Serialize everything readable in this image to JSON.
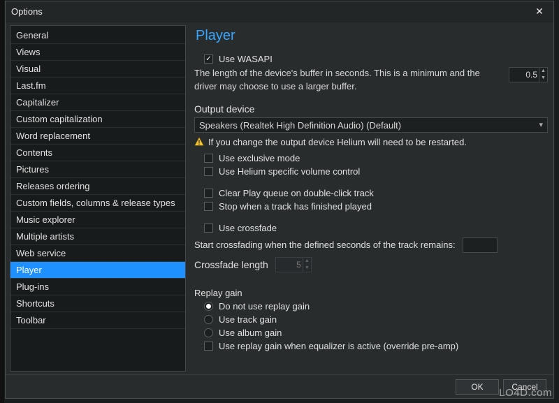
{
  "window": {
    "title": "Options"
  },
  "sidebar": {
    "items": [
      "General",
      "Views",
      "Visual",
      "Last.fm",
      "Capitalizer",
      "Custom capitalization",
      "Word replacement",
      "Contents",
      "Pictures",
      "Releases ordering",
      "Custom fields, columns & release types",
      "Music explorer",
      "Multiple artists",
      "Web service",
      "Player",
      "Plug-ins",
      "Shortcuts",
      "Toolbar"
    ],
    "selected_index": 14
  },
  "page": {
    "title": "Player",
    "use_wasapi": {
      "label": "Use WASAPI",
      "checked": true
    },
    "buffer": {
      "desc": "The length of the device's buffer in seconds. This is a minimum and the driver may choose to use a larger buffer.",
      "value": "0.5"
    },
    "output": {
      "label": "Output device",
      "value": "Speakers (Realtek High Definition Audio) (Default)",
      "warning": "If you change the output device Helium will need to be restarted."
    },
    "exclusive": {
      "label": "Use exclusive mode",
      "checked": false
    },
    "helium_volume": {
      "label": "Use Helium specific volume control",
      "checked": false
    },
    "clear_queue": {
      "label": "Clear Play queue on double-click track",
      "checked": false
    },
    "stop_finished": {
      "label": "Stop when a track has finished played",
      "checked": false
    },
    "use_crossfade": {
      "label": "Use crossfade",
      "checked": false
    },
    "crossfade_start": {
      "label": "Start crossfading when the defined seconds of the track remains:"
    },
    "crossfade_len": {
      "label": "Crossfade length",
      "value": "5"
    },
    "replay_gain": {
      "header": "Replay gain",
      "options": [
        {
          "label": "Do not use replay gain",
          "checked": true
        },
        {
          "label": "Use track gain",
          "checked": false
        },
        {
          "label": "Use album gain",
          "checked": false
        }
      ],
      "equalizer": {
        "label": "Use replay gain when equalizer is active (override pre-amp)",
        "checked": false
      }
    }
  },
  "footer": {
    "ok": "OK",
    "cancel": "Cancel"
  },
  "watermark": "LO4D.com"
}
